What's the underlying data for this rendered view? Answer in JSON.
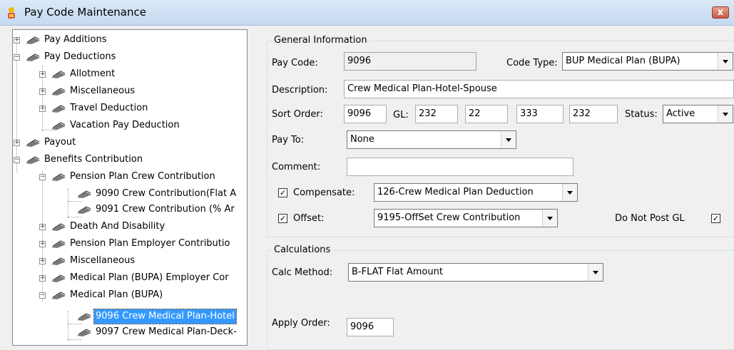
{
  "window": {
    "title": "Pay Code Maintenance",
    "close_label": "x"
  },
  "tree": {
    "pay_additions": "Pay Additions",
    "pay_deductions": "Pay Deductions",
    "allotment": "Allotment",
    "miscellaneous_1": "Miscellaneous",
    "travel_deduction": "Travel Deduction",
    "vacation_pay_deduction": "Vacation Pay Deduction",
    "payout": "Payout",
    "benefits_contribution": "Benefits Contribution",
    "pension_crew": "Pension Plan Crew Contribution",
    "item_9090": "9090 Crew Contribution(Flat A",
    "item_9091": "9091 Crew Contribution (% Ar",
    "death_disability": "Death And Disability",
    "pension_employer": "Pension Plan Employer Contributio",
    "miscellaneous_2": "Miscellaneous",
    "medical_employer": "Medical Plan (BUPA) Employer Cor",
    "medical_plan": "Medical Plan (BUPA)",
    "item_9096": "9096 Crew Medical Plan-Hotel",
    "item_9097": "9097 Crew Medical Plan-Deck-"
  },
  "general": {
    "legend": "General Information",
    "pay_code_label": "Pay Code:",
    "pay_code": "9096",
    "code_type_label": "Code Type:",
    "code_type": "BUP Medical Plan (BUPA)",
    "description_label": "Description:",
    "description": "Crew Medical Plan-Hotel-Spouse",
    "sort_order_label": "Sort Order:",
    "sort_order": "9096",
    "gl_label": "GL:",
    "gl1": "232",
    "gl2": "22",
    "gl3": "333",
    "gl4": "232",
    "status_label": "Status:",
    "status": "Active",
    "pay_to_label": "Pay To:",
    "pay_to": "None",
    "comment_label": "Comment:",
    "comment": "",
    "compensate_label": "Compensate:",
    "compensate_checked": "✓",
    "compensate": "126-Crew Medical Plan Deduction",
    "offset_label": "Offset:",
    "offset_checked": "✓",
    "offset": "9195-OffSet Crew Contribution",
    "do_not_post_label": "Do Not Post GL",
    "do_not_post_checked": "✓"
  },
  "calculations": {
    "legend": "Calculations",
    "calc_method_label": "Calc Method:",
    "calc_method": "B-FLAT Flat Amount",
    "apply_order_label": "Apply Order:",
    "apply_order": "9096"
  }
}
